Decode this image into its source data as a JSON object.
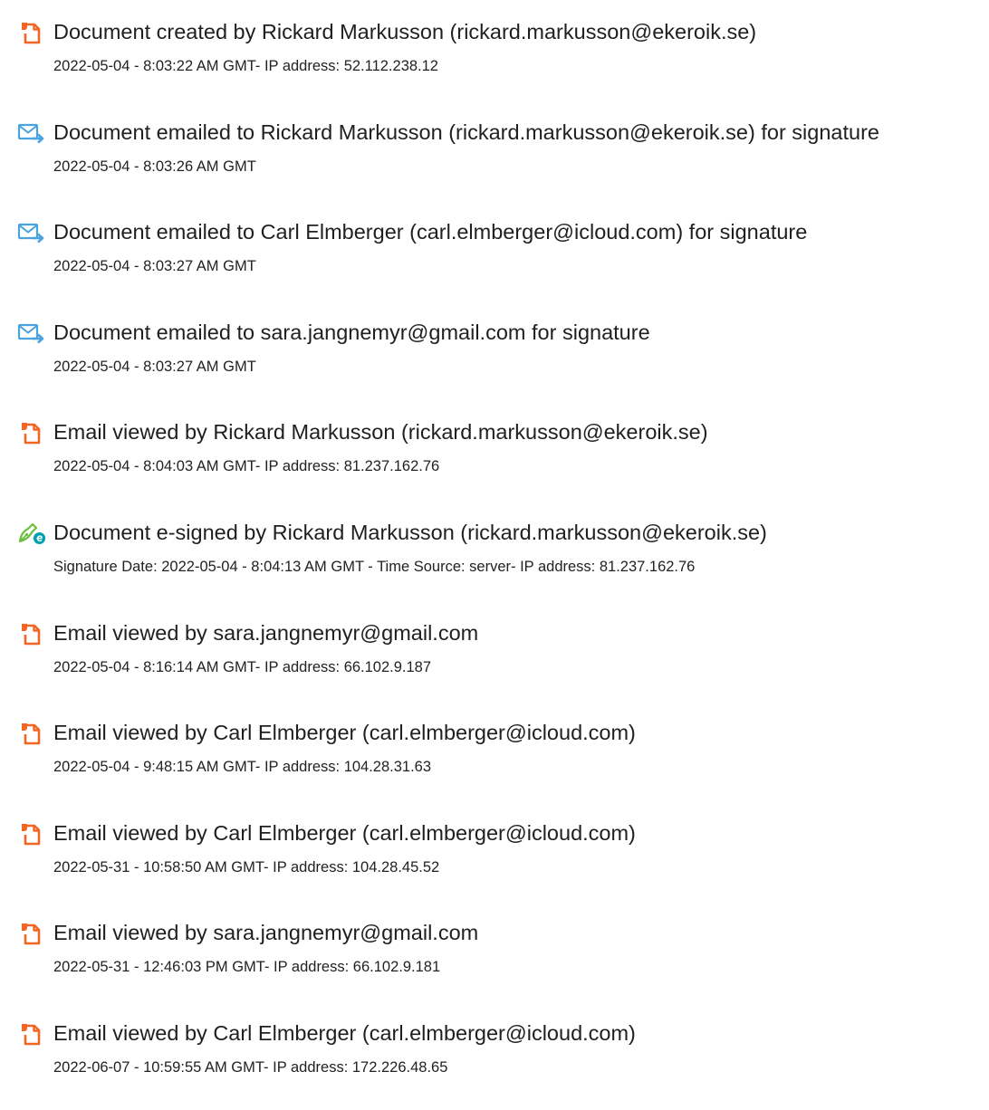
{
  "colors": {
    "doc_icon": "#f26522",
    "mail_icon": "#4aa3df",
    "sign_icon": "#6cbf3f",
    "sign_badge": "#00a0b0"
  },
  "events": [
    {
      "icon": "document-icon",
      "title": "Document created by Rickard Markusson (rickard.markusson@ekeroik.se)",
      "meta": "2022-05-04 - 8:03:22 AM GMT- IP address: 52.112.238.12"
    },
    {
      "icon": "email-sent-icon",
      "title": "Document emailed to Rickard Markusson (rickard.markusson@ekeroik.se) for signature",
      "meta": "2022-05-04 - 8:03:26 AM GMT"
    },
    {
      "icon": "email-sent-icon",
      "title": "Document emailed to Carl Elmberger (carl.elmberger@icloud.com) for signature",
      "meta": "2022-05-04 - 8:03:27 AM GMT"
    },
    {
      "icon": "email-sent-icon",
      "title": "Document emailed to sara.jangnemyr@gmail.com for signature",
      "meta": "2022-05-04 - 8:03:27 AM GMT"
    },
    {
      "icon": "document-icon",
      "title": "Email viewed by Rickard Markusson (rickard.markusson@ekeroik.se)",
      "meta": "2022-05-04 - 8:04:03 AM GMT- IP address: 81.237.162.76"
    },
    {
      "icon": "e-sign-icon",
      "title": "Document e-signed by Rickard Markusson (rickard.markusson@ekeroik.se)",
      "meta": "Signature Date: 2022-05-04 - 8:04:13 AM GMT - Time Source: server- IP address: 81.237.162.76"
    },
    {
      "icon": "document-icon",
      "title": "Email viewed by sara.jangnemyr@gmail.com",
      "meta": "2022-05-04 - 8:16:14 AM GMT- IP address: 66.102.9.187"
    },
    {
      "icon": "document-icon",
      "title": "Email viewed by Carl Elmberger (carl.elmberger@icloud.com)",
      "meta": "2022-05-04 - 9:48:15 AM GMT- IP address: 104.28.31.63"
    },
    {
      "icon": "document-icon",
      "title": "Email viewed by Carl Elmberger (carl.elmberger@icloud.com)",
      "meta": "2022-05-31 - 10:58:50 AM GMT- IP address: 104.28.45.52"
    },
    {
      "icon": "document-icon",
      "title": "Email viewed by sara.jangnemyr@gmail.com",
      "meta": "2022-05-31 - 12:46:03 PM GMT- IP address: 66.102.9.181"
    },
    {
      "icon": "document-icon",
      "title": "Email viewed by Carl Elmberger (carl.elmberger@icloud.com)",
      "meta": "2022-06-07 - 10:59:55 AM GMT- IP address: 172.226.48.65"
    }
  ]
}
